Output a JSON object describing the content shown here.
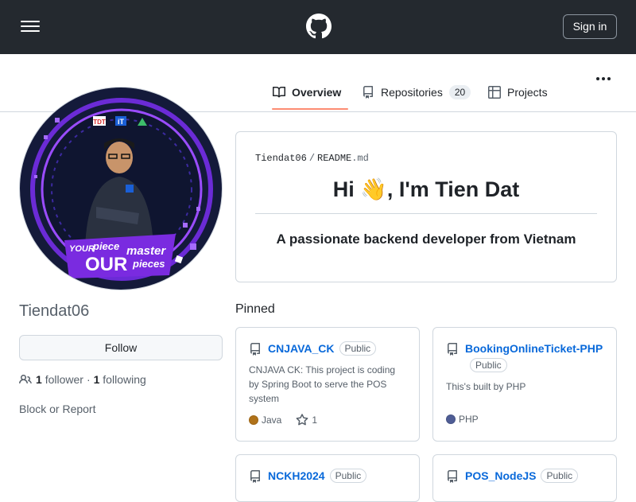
{
  "header": {
    "signin_label": "Sign in",
    "logo_icon": "github-mark-icon",
    "menu_icon": "hamburger-icon"
  },
  "tabs": [
    {
      "label": "Overview",
      "icon": "book-icon",
      "active": true
    },
    {
      "label": "Repositories",
      "icon": "repo-icon",
      "count": "20"
    },
    {
      "label": "Projects",
      "icon": "table-icon"
    }
  ],
  "profile": {
    "username": "Tiendat06",
    "follow_label": "Follow",
    "followers_count": "1",
    "followers_label": "follower",
    "separator": "·",
    "following_count": "1",
    "following_label": "following",
    "block_label": "Block or Report",
    "avatar_banner": {
      "line1": "YOUR",
      "line2": "piece",
      "line3": "OUR",
      "line4": "master",
      "line5": "pieces",
      "badge1": "TDT",
      "badge2": "iT"
    }
  },
  "readme": {
    "owner": "Tiendat06",
    "sep": "/",
    "file": "README",
    "ext": ".md",
    "heading": "Hi 👋, I'm Tien Dat",
    "subheading": "A passionate backend developer from Vietnam"
  },
  "pinned": {
    "title": "Pinned",
    "cards": [
      {
        "name": "CNJAVA_CK",
        "visibility": "Public",
        "description": "CNJAVA CK: This project is coding by Spring Boot to serve the POS system",
        "language": "Java",
        "language_color": "#b07219",
        "stars": "1"
      },
      {
        "name": "BookingOnlineTicket-PHP",
        "visibility": "Public",
        "description": "This's built by PHP",
        "language": "PHP",
        "language_color": "#4F5D95"
      },
      {
        "name": "NCKH2024",
        "visibility": "Public"
      },
      {
        "name": "POS_NodeJS",
        "visibility": "Public"
      }
    ]
  },
  "colors": {
    "header_bg": "#24292f",
    "link": "#0969da",
    "active_tab_underline": "#fd8c73"
  }
}
